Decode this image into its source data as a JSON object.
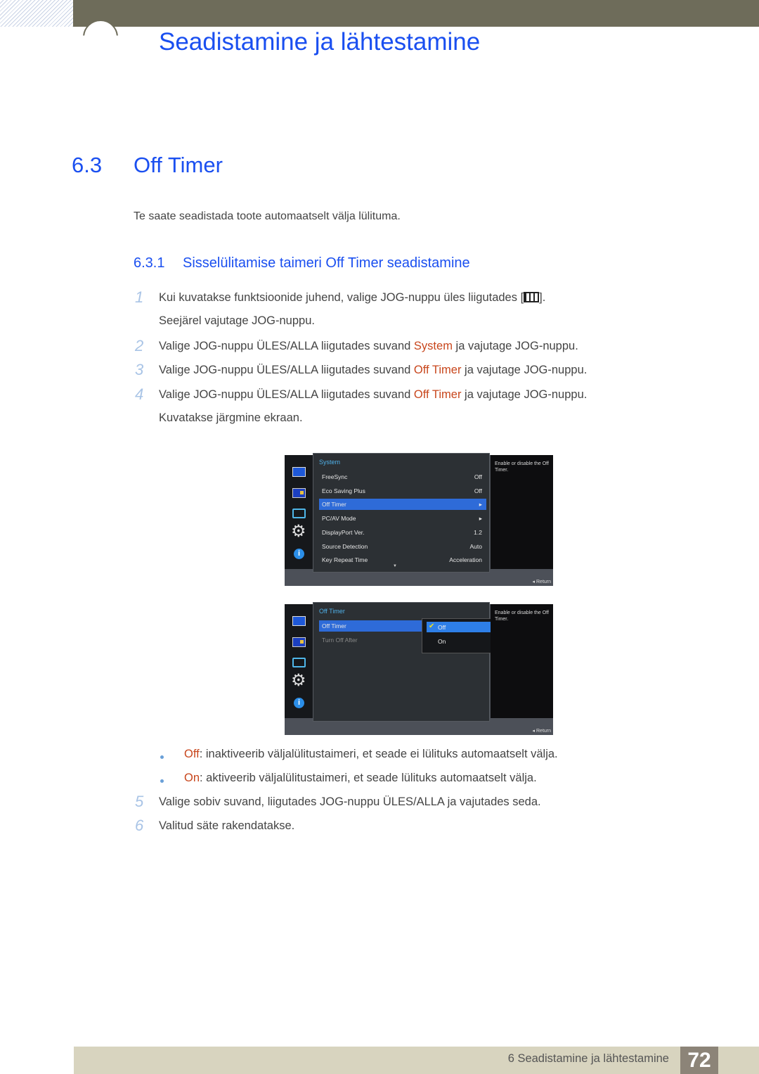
{
  "chapter": {
    "title": "Seadistamine ja lähtestamine"
  },
  "section": {
    "number": "6.3",
    "title": "Off Timer",
    "intro": "Te saate seadistada toote automaatselt välja lülituma."
  },
  "subsection": {
    "number": "6.3.1",
    "title": "Sisselülitamise taimeri Off Timer seadistamine"
  },
  "steps": [
    {
      "num": "1",
      "pre": "Kui kuvatakse funktsioonide juhend, valige JOG-nuppu üles liigutades [",
      "post": "].",
      "line2": "Seejärel vajutage JOG-nuppu.",
      "icon": "menu-grid-icon"
    },
    {
      "num": "2",
      "pre": "Valige JOG-nuppu ÜLES/ALLA liigutades suvand ",
      "hl": "System",
      "post": " ja vajutage JOG-nuppu."
    },
    {
      "num": "3",
      "pre": "Valige JOG-nuppu ÜLES/ALLA liigutades suvand ",
      "hl": "Off Timer",
      "post": " ja vajutage JOG-nuppu."
    },
    {
      "num": "4",
      "pre": "Valige JOG-nuppu ÜLES/ALLA liigutades suvand ",
      "hl": "Off Timer",
      "post": " ja vajutage JOG-nuppu.",
      "line2": "Kuvatakse järgmine ekraan."
    },
    {
      "num": "5",
      "text": "Valige sobiv suvand, liigutades JOG-nuppu ÜLES/ALLA ja vajutades seda."
    },
    {
      "num": "6",
      "text": "Valitud säte rakendatakse."
    }
  ],
  "bullets": [
    {
      "hl": "Off",
      "text": ": inaktiveerib väljalülitustaimeri, et seade ei lülituks automaatselt välja."
    },
    {
      "hl": "On",
      "text": ": aktiveerib väljalülitustaimeri, et seade lülituks automaatselt välja."
    }
  ],
  "osd1": {
    "title": "System",
    "rows": [
      {
        "label": "FreeSync",
        "value": "Off"
      },
      {
        "label": "Eco Saving Plus",
        "value": "Off"
      },
      {
        "label": "Off Timer",
        "value": "▸",
        "selected": true
      },
      {
        "label": "PC/AV Mode",
        "value": "▸"
      },
      {
        "label": "DisplayPort Ver.",
        "value": "1.2"
      },
      {
        "label": "Source Detection",
        "value": "Auto"
      },
      {
        "label": "Key Repeat Time",
        "value": "Acceleration"
      }
    ],
    "help": "Enable or disable the Off Timer.",
    "return": "◂  Return"
  },
  "osd2": {
    "title": "Off Timer",
    "rows": [
      {
        "label": "Off Timer",
        "selected": true
      },
      {
        "label": "Turn Off After",
        "disabled": true
      }
    ],
    "options": [
      {
        "label": "Off",
        "checked": true
      },
      {
        "label": "On"
      }
    ],
    "help": "Enable or disable the Off Timer.",
    "return": "◂  Return"
  },
  "footer": {
    "text": "6 Seadistamine ja lähtestamine",
    "page": "72"
  }
}
